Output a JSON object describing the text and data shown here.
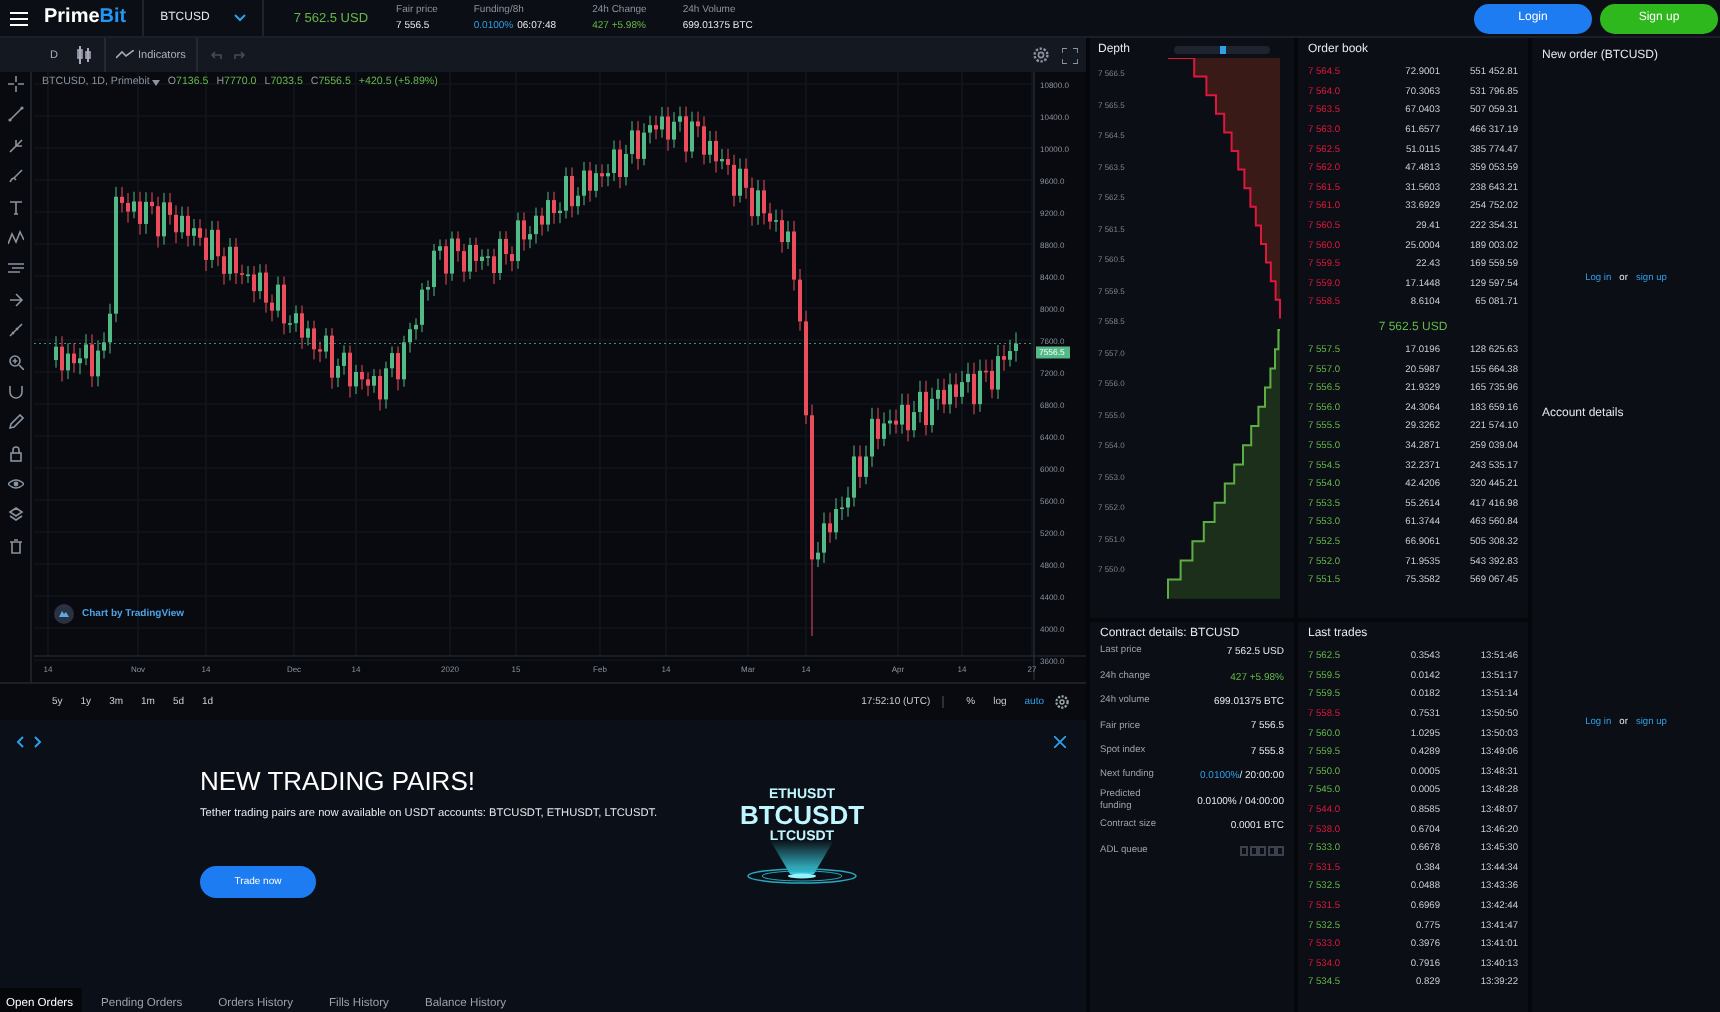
{
  "topbar": {
    "logo": {
      "main": "Prime",
      "accent": "Bit"
    },
    "symbol": "BTCUSD",
    "last_price": "7 562.5 USD",
    "stats": [
      {
        "label": "Fair price",
        "kind": "plain",
        "value": "7 556.5"
      },
      {
        "label": "Funding/8h",
        "kind": "funding",
        "value": "0.0100%",
        "extra": "06:07:48"
      },
      {
        "label": "24h Change",
        "kind": "up",
        "value": "427 +5.98%"
      },
      {
        "label": "24h Volume",
        "kind": "plain",
        "value": "699.01375 BTC"
      }
    ],
    "buttons": [
      {
        "label": "Login",
        "kind": "primary"
      },
      {
        "label": "Sign up",
        "kind": "success"
      }
    ]
  },
  "chart": {
    "interval": "D",
    "indicators": "Indicators",
    "legend": {
      "symbol": "BTCUSD, 1D, Primebit",
      "values": [
        {
          "label": "O",
          "value": "7136.5"
        },
        {
          "label": "H",
          "value": "7770.0"
        },
        {
          "label": "L",
          "value": "7033.5"
        },
        {
          "label": "C",
          "value": "7556.5"
        }
      ],
      "change": "+420.5 (+5.89%)"
    },
    "yticks": [
      "10800.0",
      "10400.0",
      "10000.0",
      "9600.0",
      "9200.0",
      "8800.0",
      "8400.0",
      "8000.0",
      "7600.0",
      "7200.0",
      "6800.0",
      "6400.0",
      "6000.0",
      "5600.0",
      "5200.0",
      "4800.0",
      "4400.0",
      "4000.0",
      "3600.0"
    ],
    "xticks": [
      "14",
      "Nov",
      "14",
      "Dec",
      "14",
      "2020",
      "15",
      "Feb",
      "14",
      "Mar",
      "14",
      "Apr",
      "14",
      "27"
    ],
    "price_tag": "7556.5",
    "credit": "Chart by TradingView",
    "ranges": [
      "5y",
      "1y",
      "3m",
      "1m",
      "5d",
      "1d"
    ],
    "clock": "17:52:10 (UTC)",
    "scale_options": [
      {
        "label": "%",
        "selected": false
      },
      {
        "label": "log",
        "selected": false
      },
      {
        "label": "auto",
        "selected": true
      }
    ]
  },
  "banner": {
    "title": "NEW TRADING PAIRS!",
    "text": "Tether trading pairs are now available on USDT accounts: BTCUSDT, ETHUSDT, LTCUSDT.",
    "button": "Trade now",
    "pairs": [
      "ETHUSDT",
      "BTCUSDT",
      "LTCUSDT"
    ]
  },
  "order_tabs": [
    {
      "label": "Open Orders",
      "selected": true
    },
    {
      "label": "Pending Orders",
      "selected": false
    },
    {
      "label": "Orders History",
      "selected": false
    },
    {
      "label": "Fills History",
      "selected": false
    },
    {
      "label": "Balance History",
      "selected": false
    }
  ],
  "depth": {
    "title": "Depth",
    "level": 0.52,
    "axis": [
      "7 566.5",
      "7 565.5",
      "7 564.5",
      "7 563.5",
      "7 562.5",
      "7 561.5",
      "7 560.5",
      "7 559.5",
      "7 558.5",
      "7 557.0",
      "7 556.0",
      "7 555.0",
      "7 554.0",
      "7 553.0",
      "7 552.0",
      "7 551.0",
      "7 550.0"
    ]
  },
  "order_book": {
    "title": "Order book",
    "asks": [
      [
        "7 564.5",
        "72.9001",
        "551 452.81"
      ],
      [
        "7 564.0",
        "70.3063",
        "531 796.85"
      ],
      [
        "7 563.5",
        "67.0403",
        "507 059.31"
      ],
      [
        "7 563.0",
        "61.6577",
        "466 317.19"
      ],
      [
        "7 562.5",
        "51.0115",
        "385 774.47"
      ],
      [
        "7 562.0",
        "47.4813",
        "359 053.59"
      ],
      [
        "7 561.5",
        "31.5603",
        "238 643.21"
      ],
      [
        "7 561.0",
        "33.6929",
        "254 752.02"
      ],
      [
        "7 560.5",
        "29.41",
        "222 354.31"
      ],
      [
        "7 560.0",
        "25.0004",
        "189 003.02"
      ],
      [
        "7 559.5",
        "22.43",
        "169 559.59"
      ],
      [
        "7 559.0",
        "17.1448",
        "129 597.54"
      ],
      [
        "7 558.5",
        "8.6104",
        "65 081.71"
      ]
    ],
    "spread": "7 562.5 USD",
    "bids": [
      [
        "7 557.5",
        "17.0196",
        "128 625.63"
      ],
      [
        "7 557.0",
        "20.5987",
        "155 664.38"
      ],
      [
        "7 556.5",
        "21.9329",
        "165 735.96"
      ],
      [
        "7 556.0",
        "24.3064",
        "183 659.16"
      ],
      [
        "7 555.5",
        "29.3262",
        "221 574.10"
      ],
      [
        "7 555.0",
        "34.2871",
        "259 039.04"
      ],
      [
        "7 554.5",
        "32.2371",
        "243 535.17"
      ],
      [
        "7 554.0",
        "42.4206",
        "320 445.21"
      ],
      [
        "7 553.5",
        "55.2614",
        "417 416.98"
      ],
      [
        "7 553.0",
        "61.3744",
        "463 560.84"
      ],
      [
        "7 552.5",
        "66.9061",
        "505 308.32"
      ],
      [
        "7 552.0",
        "71.9535",
        "543 392.83"
      ],
      [
        "7 551.5",
        "75.3582",
        "569 067.45"
      ]
    ]
  },
  "contract": {
    "title": "Contract details: BTCUSD",
    "rows": [
      {
        "label": "Last price",
        "kind": "plain",
        "value": "7 562.5 USD"
      },
      {
        "label": "24h change",
        "kind": "up",
        "value": "427 +5.98%"
      },
      {
        "label": "24h volume",
        "kind": "plain",
        "value": "699.01375 BTC"
      },
      {
        "label": "Fair price",
        "kind": "plain",
        "value": "7 556.5"
      },
      {
        "label": "Spot index",
        "kind": "plain",
        "value": "7 555.8"
      },
      {
        "label": "Next funding",
        "kind": "funding",
        "value": "0.0100%",
        "extra": "/ 20:00:00"
      },
      {
        "label": "Predicted funding",
        "kind": "plain",
        "value": "0.0100% / 04:00:00"
      },
      {
        "label": "Contract size",
        "kind": "plain",
        "value": "0.0001 BTC"
      },
      {
        "label": "ADL queue",
        "kind": "queue"
      }
    ]
  },
  "last_trades": {
    "title": "Last trades",
    "rows": [
      {
        "price": "7 562.5",
        "size": "0.3543",
        "time": "13:51:46",
        "kind": "buy"
      },
      {
        "price": "7 559.5",
        "size": "0.0142",
        "time": "13:51:17",
        "kind": "buy"
      },
      {
        "price": "7 559.5",
        "size": "0.0182",
        "time": "13:51:14",
        "kind": "buy"
      },
      {
        "price": "7 558.5",
        "size": "0.7531",
        "time": "13:50:50",
        "kind": "sell"
      },
      {
        "price": "7 560.0",
        "size": "1.0295",
        "time": "13:50:03",
        "kind": "buy"
      },
      {
        "price": "7 559.5",
        "size": "0.4289",
        "time": "13:49:06",
        "kind": "buy"
      },
      {
        "price": "7 550.0",
        "size": "0.0005",
        "time": "13:48:31",
        "kind": "buy"
      },
      {
        "price": "7 545.0",
        "size": "0.0005",
        "time": "13:48:28",
        "kind": "buy"
      },
      {
        "price": "7 544.0",
        "size": "0.8585",
        "time": "13:48:07",
        "kind": "sell"
      },
      {
        "price": "7 538.0",
        "size": "0.6704",
        "time": "13:46:20",
        "kind": "sell"
      },
      {
        "price": "7 533.0",
        "size": "0.6678",
        "time": "13:45:30",
        "kind": "buy"
      },
      {
        "price": "7 531.5",
        "size": "0.384",
        "time": "13:44:34",
        "kind": "sell"
      },
      {
        "price": "7 532.5",
        "size": "0.0488",
        "time": "13:43:36",
        "kind": "buy"
      },
      {
        "price": "7 531.5",
        "size": "0.6969",
        "time": "13:42:44",
        "kind": "sell"
      },
      {
        "price": "7 532.5",
        "size": "0.775",
        "time": "13:41:47",
        "kind": "buy"
      },
      {
        "price": "7 533.0",
        "size": "0.3976",
        "time": "13:41:01",
        "kind": "sell"
      },
      {
        "price": "7 534.0",
        "size": "0.7916",
        "time": "13:40:13",
        "kind": "sell"
      },
      {
        "price": "7 534.5",
        "size": "0.829",
        "time": "13:39:22",
        "kind": "buy"
      }
    ]
  },
  "side_panel": [
    {
      "title": "New order (BTCUSD)",
      "login": "Log in",
      "or": "or",
      "signup": "sign up"
    },
    {
      "title": "Account details",
      "login": "Log in",
      "or": "or",
      "signup": "sign up"
    }
  ]
}
